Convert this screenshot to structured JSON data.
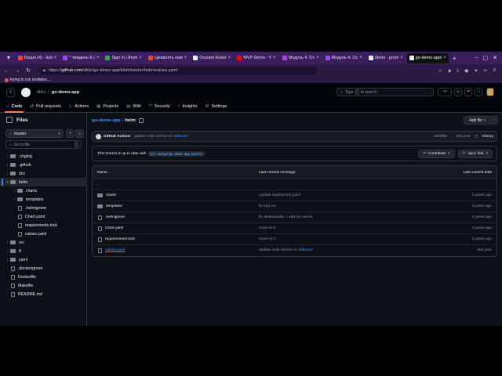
{
  "browser": {
    "tabs": [
      {
        "label": "Вхідні (4) - kuli",
        "color": "#ea4335"
      },
      {
        "label": "* тиждень-5 (",
        "color": "#a142f4"
      },
      {
        "label": "Sign in | Anim",
        "color": "#34a853"
      },
      {
        "label": "Цікавлять ном",
        "color": "#ea4335"
      },
      {
        "label": "Основи Kuber",
        "color": "#e6edf3"
      },
      {
        "label": "MVP Demo - Y",
        "color": "#ff0000"
      },
      {
        "label": "Модуль 4. Ос",
        "color": "#a142f4"
      },
      {
        "label": "Модуль 4. Ос",
        "color": "#a142f4"
      },
      {
        "label": "demo · prom",
        "color": "#e6edf3"
      },
      {
        "label": "go-demo-app/",
        "color": "#e6edf3",
        "active": true
      }
    ],
    "url_prefix": "https://",
    "url_host": "github.com",
    "url_path": "/dkliv/go-demo-app/blob/master/helm/values.yaml",
    "notice": "trying to run modules ..."
  },
  "github": {
    "owner": "dkliv",
    "repo": "go-demo-app",
    "search_placeholder": "Type",
    "search_key": "/",
    "search_suffix": "to search",
    "tabs": [
      {
        "label": "Code",
        "icon": "code-icon",
        "selected": true
      },
      {
        "label": "Pull requests",
        "icon": "pr-icon"
      },
      {
        "label": "Actions",
        "icon": "play-icon"
      },
      {
        "label": "Projects",
        "icon": "table-icon"
      },
      {
        "label": "Wiki",
        "icon": "book-icon"
      },
      {
        "label": "Security",
        "icon": "shield-icon"
      },
      {
        "label": "Insights",
        "icon": "graph-icon"
      },
      {
        "label": "Settings",
        "icon": "gear-icon"
      }
    ]
  },
  "sidebar": {
    "title": "Files",
    "branch": "master",
    "goto_placeholder": "Go to file",
    "goto_key": "t",
    "tree": [
      {
        "name": ".chglog",
        "type": "folder",
        "depth": 0,
        "expanded": false
      },
      {
        "name": ".github",
        "type": "folder",
        "depth": 0,
        "expanded": false
      },
      {
        "name": "doc",
        "type": "folder",
        "depth": 0,
        "expanded": false
      },
      {
        "name": "helm",
        "type": "folder",
        "depth": 0,
        "expanded": true,
        "selected": true
      },
      {
        "name": "charts",
        "type": "folder",
        "depth": 1,
        "expanded": false
      },
      {
        "name": "templates",
        "type": "folder",
        "depth": 1,
        "expanded": false
      },
      {
        "name": ".helmignore",
        "type": "file",
        "depth": 1
      },
      {
        "name": "Chart.yaml",
        "type": "file",
        "depth": 1
      },
      {
        "name": "requirements.lock",
        "type": "file",
        "depth": 1
      },
      {
        "name": "values.yaml",
        "type": "file",
        "depth": 1
      },
      {
        "name": "src",
        "type": "folder",
        "depth": 0,
        "expanded": false
      },
      {
        "name": "tf",
        "type": "folder",
        "depth": 0,
        "expanded": false
      },
      {
        "name": "yaml",
        "type": "folder",
        "depth": 0,
        "expanded": false
      },
      {
        "name": ".dockerignore",
        "type": "file",
        "depth": 0
      },
      {
        "name": "Dockerfile",
        "type": "file",
        "depth": 0
      },
      {
        "name": "Makefile",
        "type": "file",
        "depth": 0
      },
      {
        "name": "README.md",
        "type": "file",
        "depth": 0
      }
    ]
  },
  "main": {
    "breadcrumb_repo": "go-demo-app",
    "breadcrumb_sep": "/",
    "breadcrumb_current": "helm",
    "add_file": "Add file",
    "commit": {
      "author": "GitHub Actions",
      "message": "update code version to",
      "sha": "6d6a1a7",
      "short_sha": "1000f6e",
      "time": "last year",
      "history": "History"
    },
    "sync": {
      "text": "This branch is up to date with",
      "ref": "kil-amiga/go-demo-app:master",
      "dot": ".",
      "contribute": "Contribute",
      "sync_fork": "Sync fork"
    },
    "table": {
      "headers": {
        "name": "Name",
        "message": "Last commit message",
        "date": "Last commit date"
      },
      "rows": [
        {
          "name": "..",
          "type": "parent",
          "message": "",
          "date": ""
        },
        {
          "name": "charts",
          "type": "folder",
          "message": "Update deployment.yaml",
          "date": "3 years ago"
        },
        {
          "name": "templates",
          "type": "folder",
          "message": "fix img svc",
          "date": "3 years ago"
        },
        {
          "name": ".helmignore",
          "type": "file",
          "message": "fix ambassador + add om secret",
          "date": "3 years ago"
        },
        {
          "name": "Chart.yaml",
          "type": "file",
          "message": "move to 3",
          "date": "2 years ago"
        },
        {
          "name": "requirements.lock",
          "type": "file",
          "message": "move to 3",
          "date": "2 years ago"
        },
        {
          "name": "values.yaml",
          "type": "file",
          "message": "update code version to",
          "sha": "6d6a1a7",
          "date": "last year",
          "link": true
        }
      ]
    }
  }
}
